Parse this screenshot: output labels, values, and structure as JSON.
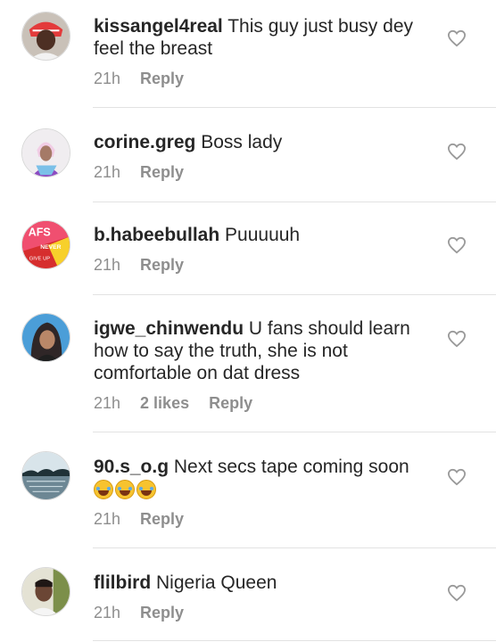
{
  "comments": [
    {
      "username": "kissangel4real",
      "text": "This guy just busy dey feel the breast",
      "time": "21h",
      "likes": "",
      "reply": "Reply"
    },
    {
      "username": "corine.greg",
      "text": "Boss lady",
      "time": "21h",
      "likes": "",
      "reply": "Reply"
    },
    {
      "username": "b.habeebullah",
      "text": "Puuuuuh",
      "time": "21h",
      "likes": "",
      "reply": "Reply"
    },
    {
      "username": "igwe_chinwendu",
      "text": "U fans should learn how to say the truth, she is not comfortable on dat dress",
      "time": "21h",
      "likes": "2 likes",
      "reply": "Reply"
    },
    {
      "username": "90.s_o.g",
      "text": "Next secs tape coming soon",
      "emoji_count": 3,
      "time": "21h",
      "likes": "",
      "reply": "Reply"
    },
    {
      "username": "flilbird",
      "text": "Nigeria Queen",
      "time": "21h",
      "likes": "",
      "reply": "Reply"
    }
  ],
  "avatar_3_text": [
    "AFS",
    "NEVER",
    "GIVE UP"
  ],
  "icons": {
    "like": "heart-outline-icon",
    "emoji": "face-with-tears-of-joy-emoji"
  }
}
